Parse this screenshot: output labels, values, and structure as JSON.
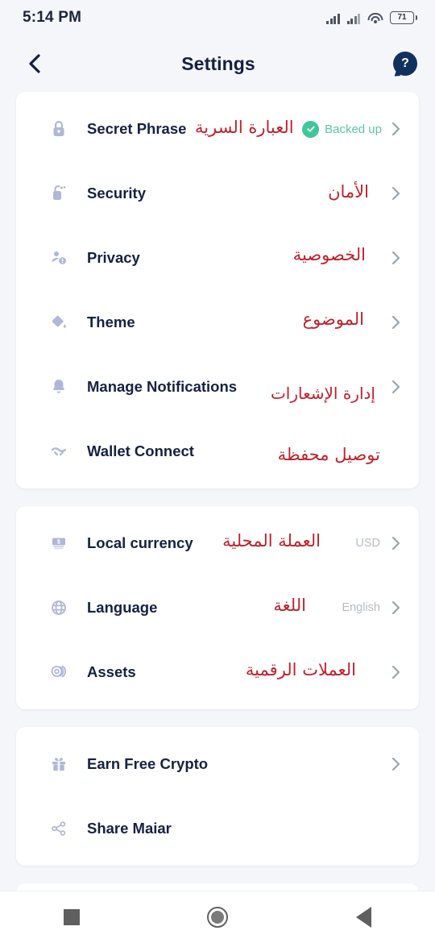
{
  "status_bar": {
    "time": "5:14 PM",
    "battery_level": "71",
    "icons": [
      "signal-bars-icon",
      "signal-bars-secondary-icon",
      "wifi-icon",
      "battery-icon"
    ]
  },
  "header": {
    "title": "Settings",
    "back_icon": "chevron-left-icon",
    "help_icon": "help-chat-bubble-icon",
    "help_label": "?"
  },
  "colors": {
    "background": "#f5f6fa",
    "card": "#ffffff",
    "label": "#152142",
    "translation_red": "#c0202a",
    "value_gray": "#b6bbc8",
    "chevron": "#9aa3b5",
    "icon": "#b0b7d6",
    "badge_green": "#3fc79a",
    "help_navy": "#12305c"
  },
  "groups": [
    {
      "name": "security-group",
      "rows": [
        {
          "icon": "lock-icon",
          "label": "Secret Phrase",
          "translation": "العبارة السرية",
          "badge": "Backed up",
          "value": "",
          "chevron": true
        },
        {
          "icon": "fingerprint-icon",
          "label": "Security",
          "translation": "الأمان",
          "badge": "",
          "value": "",
          "chevron": true
        },
        {
          "icon": "privacy-person-icon",
          "label": "Privacy",
          "translation": "الخصوصية",
          "badge": "",
          "value": "",
          "chevron": true
        },
        {
          "icon": "paint-bucket-icon",
          "label": "Theme",
          "translation": "الموضوع",
          "badge": "",
          "value": "",
          "chevron": true
        },
        {
          "icon": "bell-icon",
          "label": "Manage Notifications",
          "translation": "إدارة الإشعارات",
          "badge": "",
          "value": "",
          "chevron": true
        },
        {
          "icon": "wallet-connect-icon",
          "label": "Wallet Connect",
          "translation": "توصيل محفظة",
          "badge": "",
          "value": "",
          "chevron": false
        }
      ]
    },
    {
      "name": "preferences-group",
      "rows": [
        {
          "icon": "banknote-icon",
          "label": "Local currency",
          "translation": "العملة المحلية",
          "badge": "",
          "value": "USD",
          "chevron": true
        },
        {
          "icon": "globe-icon",
          "label": "Language",
          "translation": "اللغة",
          "badge": "",
          "value": "English",
          "chevron": true
        },
        {
          "icon": "coins-icon",
          "label": "Assets",
          "translation": "العملات الرقمية",
          "badge": "",
          "value": "",
          "chevron": true
        }
      ]
    },
    {
      "name": "extras-group",
      "rows": [
        {
          "icon": "gift-icon",
          "label": "Earn Free Crypto",
          "translation": "",
          "badge": "",
          "value": "",
          "chevron": true
        },
        {
          "icon": "share-icon",
          "label": "Share Maiar",
          "translation": "",
          "badge": "",
          "value": "",
          "chevron": false
        }
      ]
    }
  ],
  "nav_bar": {
    "recents": "square-recents-icon",
    "home": "circle-home-icon",
    "back": "triangle-back-icon"
  }
}
